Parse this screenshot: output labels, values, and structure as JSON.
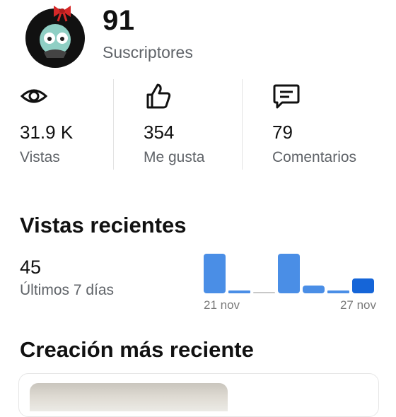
{
  "channel": {
    "subscriber_count": "91",
    "subscriber_label": "Suscriptores"
  },
  "stats": [
    {
      "icon": "eye-icon",
      "value": "31.9 K",
      "label": "Vistas"
    },
    {
      "icon": "thumbs-up-icon",
      "value": "354",
      "label": "Me gusta"
    },
    {
      "icon": "comment-icon",
      "value": "79",
      "label": "Comentarios"
    }
  ],
  "recent_views": {
    "title": "Vistas recientes",
    "value": "45",
    "period_label": "Últimos 7 días"
  },
  "latest_creation": {
    "title": "Creación más reciente"
  },
  "colors": {
    "bar": "#4a8ee6",
    "bar_today": "#1565d8",
    "bar_zero": "#c8c8c8"
  },
  "chart_data": {
    "type": "bar",
    "categories": [
      "21 nov",
      "22 nov",
      "23 nov",
      "24 nov",
      "25 nov",
      "26 nov",
      "27 nov"
    ],
    "tick_labels": [
      "21 nov",
      "27 nov"
    ],
    "values": [
      16,
      1,
      0,
      16,
      3,
      1,
      6
    ],
    "ylim": [
      0,
      16
    ]
  }
}
